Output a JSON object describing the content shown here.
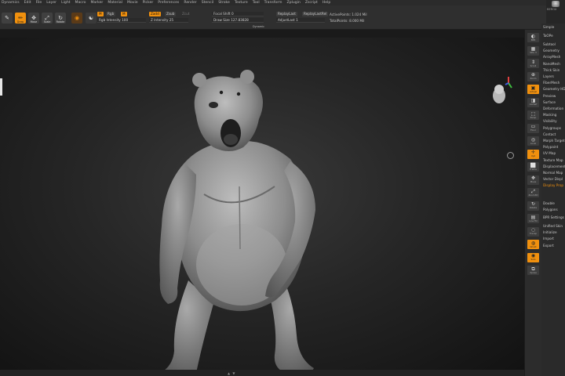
{
  "menu": [
    "Dynamics",
    "Edit",
    "File",
    "Layer",
    "Light",
    "Macro",
    "Marker",
    "Material",
    "Movie",
    "Picker",
    "Preferences",
    "Render",
    "Stencil",
    "Stroke",
    "Texture",
    "Tool",
    "Transform",
    "Zplugin",
    "Zscript",
    "Help"
  ],
  "shelf": {
    "edit_label": "Edit",
    "draw_label": "Draw",
    "move_label": "Move",
    "scale_label": "Scale",
    "rotate_label": "Rotate",
    "mrgb": "M",
    "rgb": "Rgb",
    "zadd": "Zadd",
    "zsub": "Zsub",
    "zcut": "Zcut",
    "rgb_intensity": "Rgb Intensity 100",
    "z_intensity": "Z Intensity 25",
    "focal_shift": "Focal Shift 0",
    "draw_size": "Draw Size 127.83828",
    "dynamic": "Dynamic",
    "replay_last": "ReplayLast",
    "replay_last_rel": "ReplayLastRel",
    "adjust_last": "AdjustLast 1",
    "active_points": "ActivePoints: 1.024 Mil",
    "total_points": "TotalPoints: 8.000 Mil"
  },
  "tray": {
    "brand": "BEROX",
    "header": "Simple",
    "subheader": "TaOPe",
    "sections": [
      "Subtool",
      "Geometry",
      "ArrayMesh",
      "NanoMesh",
      "Thick Skin",
      "Layers",
      "FiberMesh",
      "Geometry HD",
      "Preview",
      "Surface",
      "Deformation",
      "Masking",
      "Visibility",
      "Polygroups",
      "Contact",
      "Morph Target",
      "Polypaint",
      "UV Map",
      "Texture Map",
      "Displacement",
      "Normal Map",
      "Vector Displ",
      "Display Prop",
      "Unified Skin",
      "Initialize",
      "Import",
      "Export"
    ],
    "divider_1": "Double",
    "divider_2": "Polygons",
    "divider_3": "BPR Settings"
  },
  "rshelf": [
    {
      "icon": "bpr-icon",
      "cap": "BPR"
    },
    {
      "icon": "spix-icon",
      "cap": "SPix 3"
    },
    {
      "icon": "scroll-icon",
      "cap": "Scroll"
    },
    {
      "icon": "zoom-icon",
      "cap": "Zoom"
    },
    {
      "icon": "actual-icon",
      "cap": "Actual"
    },
    {
      "icon": "aahalf-icon",
      "cap": "AAHalf"
    },
    {
      "icon": "persp-icon",
      "cap": "Persp"
    },
    {
      "icon": "floor-icon",
      "cap": "Floor"
    },
    {
      "icon": "local-icon",
      "cap": "Local"
    },
    {
      "icon": "xyz-icon",
      "cap": "Xyz"
    },
    {
      "icon": "frame-icon",
      "cap": "Frame"
    },
    {
      "icon": "move-icon",
      "cap": "Move"
    },
    {
      "icon": "zoom3d-icon",
      "cap": "Zoom3D"
    },
    {
      "icon": "rotate-icon",
      "cap": "Rotate"
    },
    {
      "icon": "linefill-icon",
      "cap": "Line Fill"
    },
    {
      "icon": "transp-icon",
      "cap": "Transp"
    },
    {
      "icon": "ghost-icon",
      "cap": "Ghost"
    },
    {
      "icon": "solo-icon",
      "cap": "Solo"
    },
    {
      "icon": "xpose-icon",
      "cap": "Xpose"
    }
  ],
  "bottom_indicator": "▲ ▼",
  "colors": {
    "accent": "#f0900e",
    "viewport_center": "#3a3a3a",
    "viewport_edge": "#121212",
    "panel": "#2f2f2f"
  }
}
